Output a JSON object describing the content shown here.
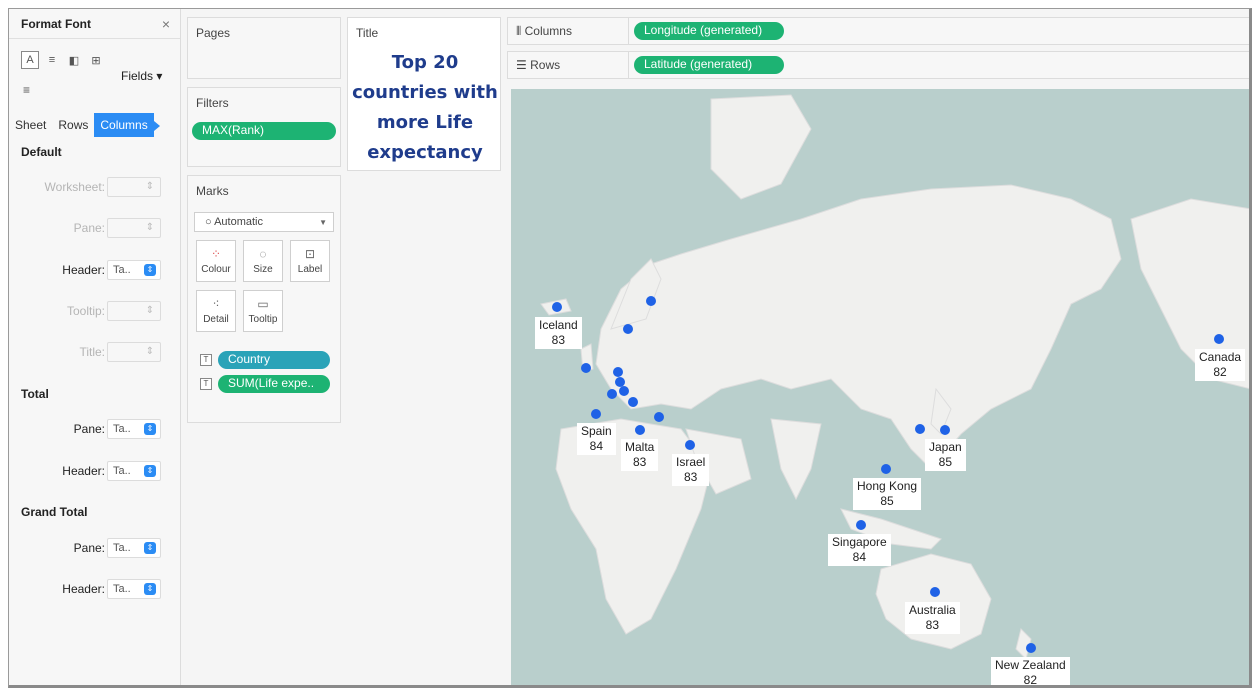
{
  "format_pane": {
    "title": "Format Font",
    "close_glyph": "×",
    "tools": [
      "A",
      "≡",
      "◧",
      "⊞"
    ],
    "fields_label": "Fields ▾",
    "align_glyph": "≡",
    "tabs": [
      "Sheet",
      "Rows",
      "Columns"
    ],
    "selected_tab": "Columns",
    "sections": {
      "default": {
        "label": "Default",
        "rows": [
          {
            "label": "Worksheet:",
            "value": ""
          },
          {
            "label": "Pane:",
            "value": ""
          },
          {
            "label": "Header:",
            "value": "Ta.."
          },
          {
            "label": "Tooltip:",
            "value": ""
          },
          {
            "label": "Title:",
            "value": ""
          }
        ]
      },
      "total": {
        "label": "Total",
        "rows": [
          {
            "label": "Pane:",
            "value": "Ta.."
          },
          {
            "label": "Header:",
            "value": "Ta.."
          }
        ]
      },
      "grand_total": {
        "label": "Grand Total",
        "rows": [
          {
            "label": "Pane:",
            "value": "Ta.."
          },
          {
            "label": "Header:",
            "value": "Ta.."
          }
        ]
      }
    }
  },
  "pages": {
    "title": "Pages"
  },
  "filters": {
    "title": "Filters",
    "pill": "MAX(Rank)"
  },
  "marks": {
    "title": "Marks",
    "mark_type": "Automatic",
    "buttons": [
      "Colour",
      "Size",
      "Label",
      "Detail",
      "Tooltip"
    ],
    "fields": [
      "Country",
      "SUM(Life expe.."
    ]
  },
  "title_card": {
    "header": "Title",
    "text_lines": [
      "Top 20",
      "countries with",
      "more Life",
      "expectancy"
    ]
  },
  "shelves": {
    "columns": {
      "label": "Columns",
      "pill": "Longitude (generated)"
    },
    "rows": {
      "label": "Rows",
      "pill": "Latitude (generated)"
    }
  },
  "map": {
    "water_color": "#b9cfcc",
    "land_color": "#f0f0ee",
    "dot_color": "#1f62e6",
    "labels": [
      {
        "name": "Iceland",
        "value": "83"
      },
      {
        "name": "Canada",
        "value": "82"
      },
      {
        "name": "Spain",
        "value": "84"
      },
      {
        "name": "Malta",
        "value": "83"
      },
      {
        "name": "Israel",
        "value": "83"
      },
      {
        "name": "Japan",
        "value": "85"
      },
      {
        "name": "Hong Kong",
        "value": "85"
      },
      {
        "name": "Singapore",
        "value": "84"
      },
      {
        "name": "Australia",
        "value": "83"
      },
      {
        "name": "New Zealand",
        "value": "82"
      }
    ]
  }
}
